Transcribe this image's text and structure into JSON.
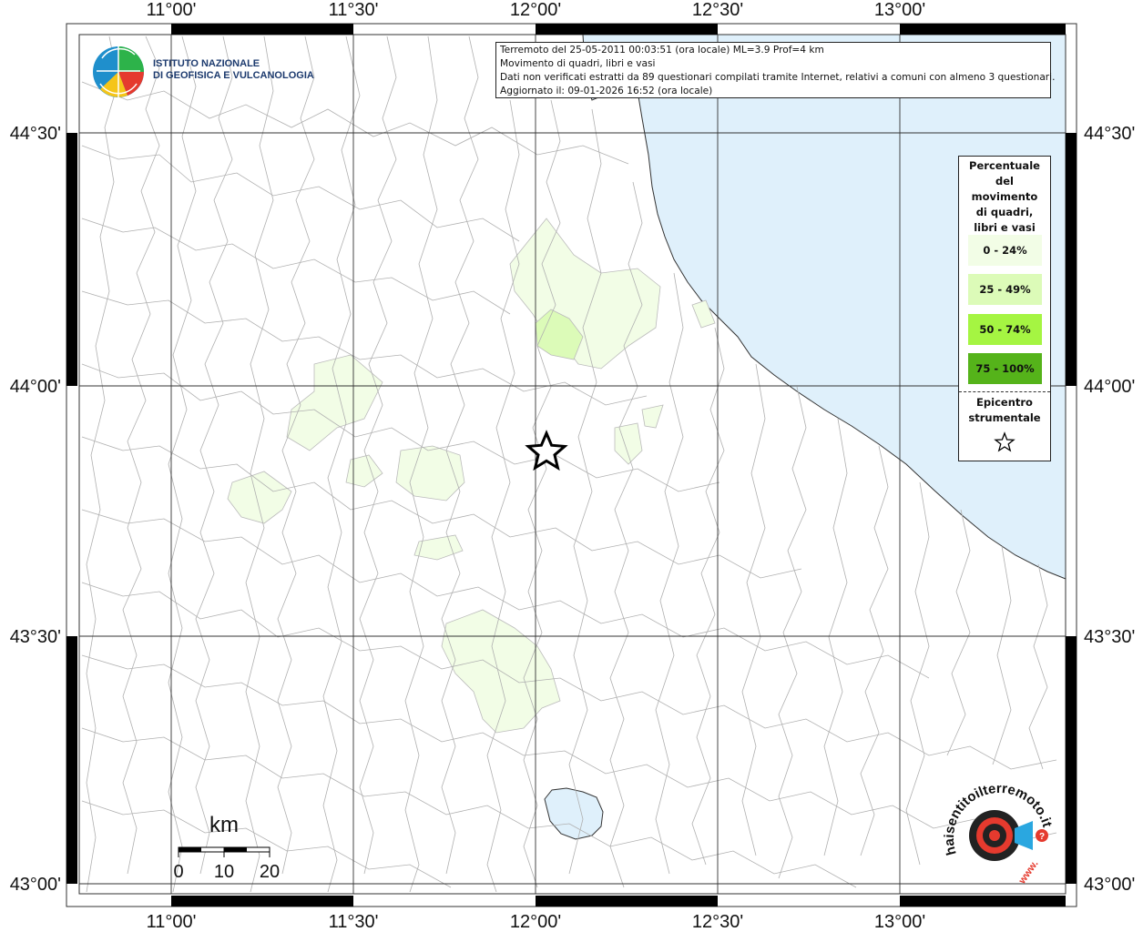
{
  "info": {
    "line1": "Terremoto del 25-05-2011 00:03:51 (ora locale) ML=3.9 Prof=4 km",
    "line2": "Movimento di quadri, libri e vasi",
    "line3": "Dati non verificati estratti da 89 questionari compilati tramite Internet, relativi a comuni con almeno 3 questionari.",
    "line4": "Aggiornato il: 09-01-2026 16:52 (ora locale)"
  },
  "logo": {
    "line1": "ISTITUTO NAZIONALE",
    "line2": "DI GEOFISICA E VULCANOLOGIA"
  },
  "axes": {
    "lon_labels": [
      "11°00'",
      "11°30'",
      "12°00'",
      "12°30'",
      "13°00'"
    ],
    "lat_labels": [
      "44°30'",
      "44°00'",
      "43°30'",
      "43°00'"
    ]
  },
  "legend": {
    "title": [
      "Percentuale",
      "del",
      "movimento",
      "di quadri,",
      "libri e vasi"
    ],
    "items": [
      {
        "label": "0 - 24%",
        "color": "#f2fde6"
      },
      {
        "label": "25 - 49%",
        "color": "#dcfbb8"
      },
      {
        "label": "50 - 74%",
        "color": "#a5f542"
      },
      {
        "label": "75 - 100%",
        "color": "#55b31a"
      }
    ],
    "epicenter": [
      "Epicentro",
      "strumentale"
    ]
  },
  "scale": {
    "unit": "km",
    "ticks": [
      "0",
      "10",
      "20"
    ]
  },
  "colors": {
    "sea": "#dff0fb",
    "lake": "#dff0fb",
    "land": "#ffffff",
    "class_1": "#f2fde6",
    "class_2": "#dcfbb8"
  },
  "hs_logo": {
    "text": "haisentitoilterremoto.it",
    "url": "www."
  }
}
